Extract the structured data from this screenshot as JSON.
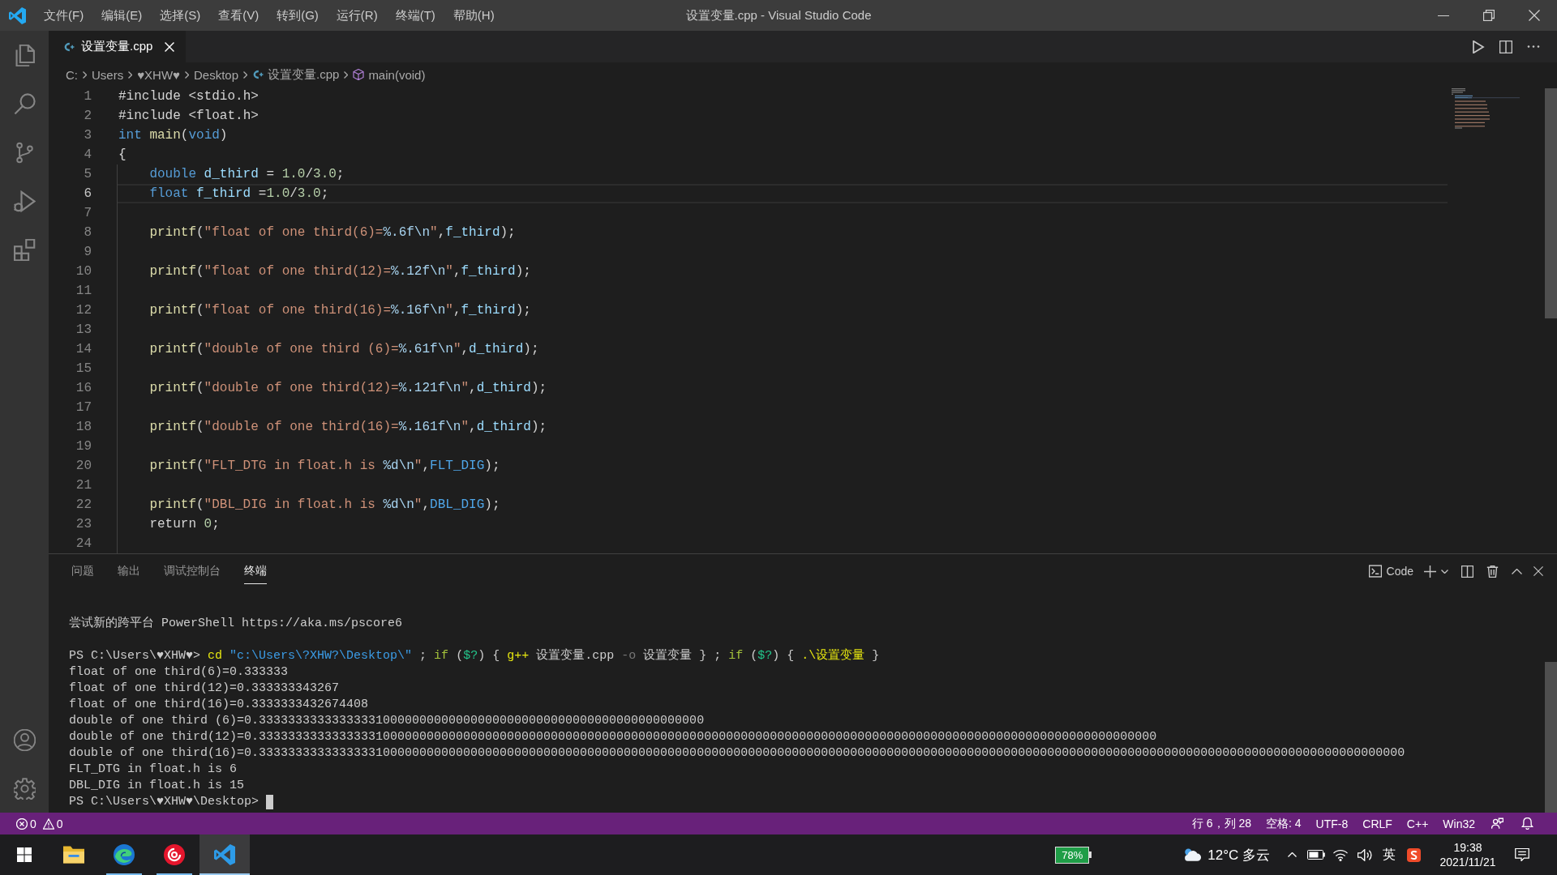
{
  "title_bar": {
    "menu": [
      "文件(F)",
      "编辑(E)",
      "选择(S)",
      "查看(V)",
      "转到(G)",
      "运行(R)",
      "终端(T)",
      "帮助(H)"
    ],
    "title": "设置变量.cpp - Visual Studio Code"
  },
  "tabs": [
    {
      "label": "设置变量.cpp",
      "selected": true
    }
  ],
  "breadcrumbs": [
    {
      "label": "C:",
      "kind": "folder"
    },
    {
      "label": "Users",
      "kind": "folder"
    },
    {
      "label": "♥XHW♥",
      "kind": "folder"
    },
    {
      "label": "Desktop",
      "kind": "folder"
    },
    {
      "label": "设置变量.cpp",
      "kind": "file"
    },
    {
      "label": "main(void)",
      "kind": "symbol"
    }
  ],
  "editor": {
    "lines": [
      {
        "number": "1",
        "current": false,
        "indented": false,
        "tokens": [
          {
            "kind": "plain",
            "text": "#include <stdio.h>"
          }
        ]
      },
      {
        "number": "2",
        "current": false,
        "indented": false,
        "tokens": [
          {
            "kind": "plain",
            "text": "#include <float.h>"
          }
        ]
      },
      {
        "number": "3",
        "current": false,
        "indented": false,
        "tokens": [
          {
            "kind": "kw",
            "text": "int"
          },
          {
            "kind": "fn",
            "text": " main"
          },
          {
            "kind": "plain",
            "text": "("
          },
          {
            "kind": "kw",
            "text": "void"
          },
          {
            "kind": "plain",
            "text": ")"
          }
        ]
      },
      {
        "number": "4",
        "current": false,
        "indented": false,
        "tokens": [
          {
            "kind": "plain",
            "text": "{"
          }
        ]
      },
      {
        "number": "5",
        "current": false,
        "indented": true,
        "tokens": [
          {
            "kind": "kw",
            "text": "double"
          },
          {
            "kind": "var",
            "text": " d_third"
          },
          {
            "kind": "plain",
            "text": " = "
          },
          {
            "kind": "num",
            "text": "1.0"
          },
          {
            "kind": "plain",
            "text": "/"
          },
          {
            "kind": "num",
            "text": "3.0"
          },
          {
            "kind": "plain",
            "text": ";"
          }
        ]
      },
      {
        "number": "6",
        "current": true,
        "indented": true,
        "tokens": [
          {
            "kind": "kw",
            "text": "float"
          },
          {
            "kind": "var",
            "text": " f_third"
          },
          {
            "kind": "plain",
            "text": " ="
          },
          {
            "kind": "num",
            "text": "1.0"
          },
          {
            "kind": "plain",
            "text": "/"
          },
          {
            "kind": "num",
            "text": "3.0"
          },
          {
            "kind": "plain",
            "text": ";"
          }
        ]
      },
      {
        "number": "7",
        "current": false
      },
      {
        "number": "8",
        "current": false,
        "indented": true,
        "tokens": [
          {
            "kind": "fn",
            "text": "printf"
          },
          {
            "kind": "plain",
            "text": "("
          },
          {
            "kind": "str",
            "text": "\"float of one third(6)="
          },
          {
            "kind": "esc",
            "text": "%.6f\\n"
          },
          {
            "kind": "str",
            "text": "\""
          },
          {
            "kind": "plain",
            "text": ","
          },
          {
            "kind": "var",
            "text": "f_third"
          },
          {
            "kind": "plain",
            "text": ");"
          }
        ]
      },
      {
        "number": "9",
        "current": false
      },
      {
        "number": "10",
        "current": false,
        "indented": true,
        "tokens": [
          {
            "kind": "fn",
            "text": "printf"
          },
          {
            "kind": "plain",
            "text": "("
          },
          {
            "kind": "str",
            "text": "\"float of one third(12)="
          },
          {
            "kind": "esc",
            "text": "%.12f\\n"
          },
          {
            "kind": "str",
            "text": "\""
          },
          {
            "kind": "plain",
            "text": ","
          },
          {
            "kind": "var",
            "text": "f_third"
          },
          {
            "kind": "plain",
            "text": ");"
          }
        ]
      },
      {
        "number": "11",
        "current": false
      },
      {
        "number": "12",
        "current": false,
        "indented": true,
        "tokens": [
          {
            "kind": "fn",
            "text": "printf"
          },
          {
            "kind": "plain",
            "text": "("
          },
          {
            "kind": "str",
            "text": "\"float of one third(16)="
          },
          {
            "kind": "esc",
            "text": "%.16f\\n"
          },
          {
            "kind": "str",
            "text": "\""
          },
          {
            "kind": "plain",
            "text": ","
          },
          {
            "kind": "var",
            "text": "f_third"
          },
          {
            "kind": "plain",
            "text": ");"
          }
        ]
      },
      {
        "number": "13",
        "current": false
      },
      {
        "number": "14",
        "current": false,
        "indented": true,
        "tokens": [
          {
            "kind": "fn",
            "text": "printf"
          },
          {
            "kind": "plain",
            "text": "("
          },
          {
            "kind": "str",
            "text": "\"double of one third (6)="
          },
          {
            "kind": "esc",
            "text": "%.61f\\n"
          },
          {
            "kind": "str",
            "text": "\""
          },
          {
            "kind": "plain",
            "text": ","
          },
          {
            "kind": "var",
            "text": "d_third"
          },
          {
            "kind": "plain",
            "text": ");"
          }
        ]
      },
      {
        "number": "15",
        "current": false
      },
      {
        "number": "16",
        "current": false,
        "indented": true,
        "tokens": [
          {
            "kind": "fn",
            "text": "printf"
          },
          {
            "kind": "plain",
            "text": "("
          },
          {
            "kind": "str",
            "text": "\"double of one third(12)="
          },
          {
            "kind": "esc",
            "text": "%.121f\\n"
          },
          {
            "kind": "str",
            "text": "\""
          },
          {
            "kind": "plain",
            "text": ","
          },
          {
            "kind": "var",
            "text": "d_third"
          },
          {
            "kind": "plain",
            "text": ");"
          }
        ]
      },
      {
        "number": "17",
        "current": false
      },
      {
        "number": "18",
        "current": false,
        "indented": true,
        "tokens": [
          {
            "kind": "fn",
            "text": "printf"
          },
          {
            "kind": "plain",
            "text": "("
          },
          {
            "kind": "str",
            "text": "\"double of one third(16)="
          },
          {
            "kind": "esc",
            "text": "%.161f\\n"
          },
          {
            "kind": "str",
            "text": "\""
          },
          {
            "kind": "plain",
            "text": ","
          },
          {
            "kind": "var",
            "text": "d_third"
          },
          {
            "kind": "plain",
            "text": ");"
          }
        ]
      },
      {
        "number": "19",
        "current": false
      },
      {
        "number": "20",
        "current": false,
        "indented": true,
        "tokens": [
          {
            "kind": "fn",
            "text": "printf"
          },
          {
            "kind": "plain",
            "text": "("
          },
          {
            "kind": "str",
            "text": "\"FLT_DTG in float.h is "
          },
          {
            "kind": "esc",
            "text": "%d\\n"
          },
          {
            "kind": "str",
            "text": "\""
          },
          {
            "kind": "plain",
            "text": ","
          },
          {
            "kind": "macro",
            "text": "FLT_DIG"
          },
          {
            "kind": "plain",
            "text": ");"
          }
        ]
      },
      {
        "number": "21",
        "current": false
      },
      {
        "number": "22",
        "current": false,
        "indented": true,
        "tokens": [
          {
            "kind": "fn",
            "text": "printf"
          },
          {
            "kind": "plain",
            "text": "("
          },
          {
            "kind": "str",
            "text": "\"DBL_DIG in float.h is "
          },
          {
            "kind": "esc",
            "text": "%d\\n"
          },
          {
            "kind": "str",
            "text": "\""
          },
          {
            "kind": "plain",
            "text": ","
          },
          {
            "kind": "macro",
            "text": "DBL_DIG"
          },
          {
            "kind": "plain",
            "text": ");"
          }
        ]
      },
      {
        "number": "23",
        "current": false,
        "indented": true,
        "tokens": [
          {
            "kind": "plain",
            "text": "return "
          },
          {
            "kind": "num",
            "text": "0"
          },
          {
            "kind": "plain",
            "text": ";"
          }
        ]
      },
      {
        "number": "24",
        "current": false
      }
    ]
  },
  "panel": {
    "tabs": [
      {
        "label": "问题",
        "selected": false
      },
      {
        "label": "输出",
        "selected": false
      },
      {
        "label": "调试控制台",
        "selected": false
      },
      {
        "label": "终端",
        "selected": true
      }
    ],
    "terminal_profile": "Code",
    "terminal": {
      "banner": "尝试新的跨平台 PowerShell https://aka.ms/pscore6",
      "lines": [
        {
          "cursor": false,
          "segments": [
            {
              "kind": "plain",
              "text": "PS C:\\Users\\♥XHW♥> "
            },
            {
              "kind": "cmd",
              "text": "cd"
            },
            {
              "kind": "str",
              "text": " \"c:\\Users\\?XHW?\\Desktop\\\""
            },
            {
              "kind": "plain",
              "text": " ; "
            },
            {
              "kind": "kw",
              "text": "if"
            },
            {
              "kind": "plain",
              "text": " ("
            },
            {
              "kind": "var",
              "text": "$?"
            },
            {
              "kind": "plain",
              "text": ") { "
            },
            {
              "kind": "cmd",
              "text": "g++"
            },
            {
              "kind": "plain",
              "text": " 设置变量.cpp "
            },
            {
              "kind": "dim",
              "text": "-o"
            },
            {
              "kind": "plain",
              "text": " 设置变量 } ; "
            },
            {
              "kind": "kw",
              "text": "if"
            },
            {
              "kind": "plain",
              "text": " ("
            },
            {
              "kind": "var",
              "text": "$?"
            },
            {
              "kind": "plain",
              "text": ") { "
            },
            {
              "kind": "cmd",
              "text": ".\\设置变量"
            },
            {
              "kind": "plain",
              "text": " }"
            }
          ]
        },
        {
          "cursor": false,
          "segments": [
            {
              "kind": "plain",
              "text": "float of one third(6)=0.333333"
            }
          ]
        },
        {
          "cursor": false,
          "segments": [
            {
              "kind": "plain",
              "text": "float of one third(12)=0.333333343267"
            }
          ]
        },
        {
          "cursor": false,
          "segments": [
            {
              "kind": "plain",
              "text": "float of one third(16)=0.3333333432674408"
            }
          ]
        },
        {
          "cursor": false,
          "segments": [
            {
              "kind": "plain",
              "text": "double of one third (6)=0.3333333333333333100000000000000000000000000000000000000000000"
            }
          ]
        },
        {
          "cursor": false,
          "segments": [
            {
              "kind": "plain",
              "text": "double of one third(12)=0.333333333333333310000000000000000000000000000000000000000000000000000000000000000000000000000000000000000000000000000000000"
            }
          ]
        },
        {
          "cursor": false,
          "segments": [
            {
              "kind": "plain",
              "text": "double of one third(16)=0.3333333333333333100000000000000000000000000000000000000000000000000000000000000000000000000000000000000000000000000000000000000000000000000000000000000000000"
            }
          ]
        },
        {
          "cursor": false,
          "segments": [
            {
              "kind": "plain",
              "text": "FLT_DTG in float.h is 6"
            }
          ]
        },
        {
          "cursor": false,
          "segments": [
            {
              "kind": "plain",
              "text": "DBL_DIG in float.h is 15"
            }
          ]
        },
        {
          "cursor": true,
          "segments": [
            {
              "kind": "plain",
              "text": "PS C:\\Users\\♥XHW♥\\Desktop>"
            }
          ]
        }
      ]
    }
  },
  "status_bar": {
    "errors": "0",
    "warnings": "0",
    "items": [
      "行 6，列 28",
      "空格: 4",
      "UTF-8",
      "CRLF",
      "C++",
      "Win32"
    ]
  },
  "taskbar": {
    "apps": [
      {
        "running": false,
        "selected": false
      },
      {
        "running": true,
        "selected": false
      },
      {
        "running": true,
        "selected": false
      },
      {
        "running": true,
        "selected": true
      }
    ],
    "battery_badge": "78%",
    "weather": "12°C 多云",
    "input_method": "英",
    "time": "19:38",
    "date": "2021/11/21"
  }
}
